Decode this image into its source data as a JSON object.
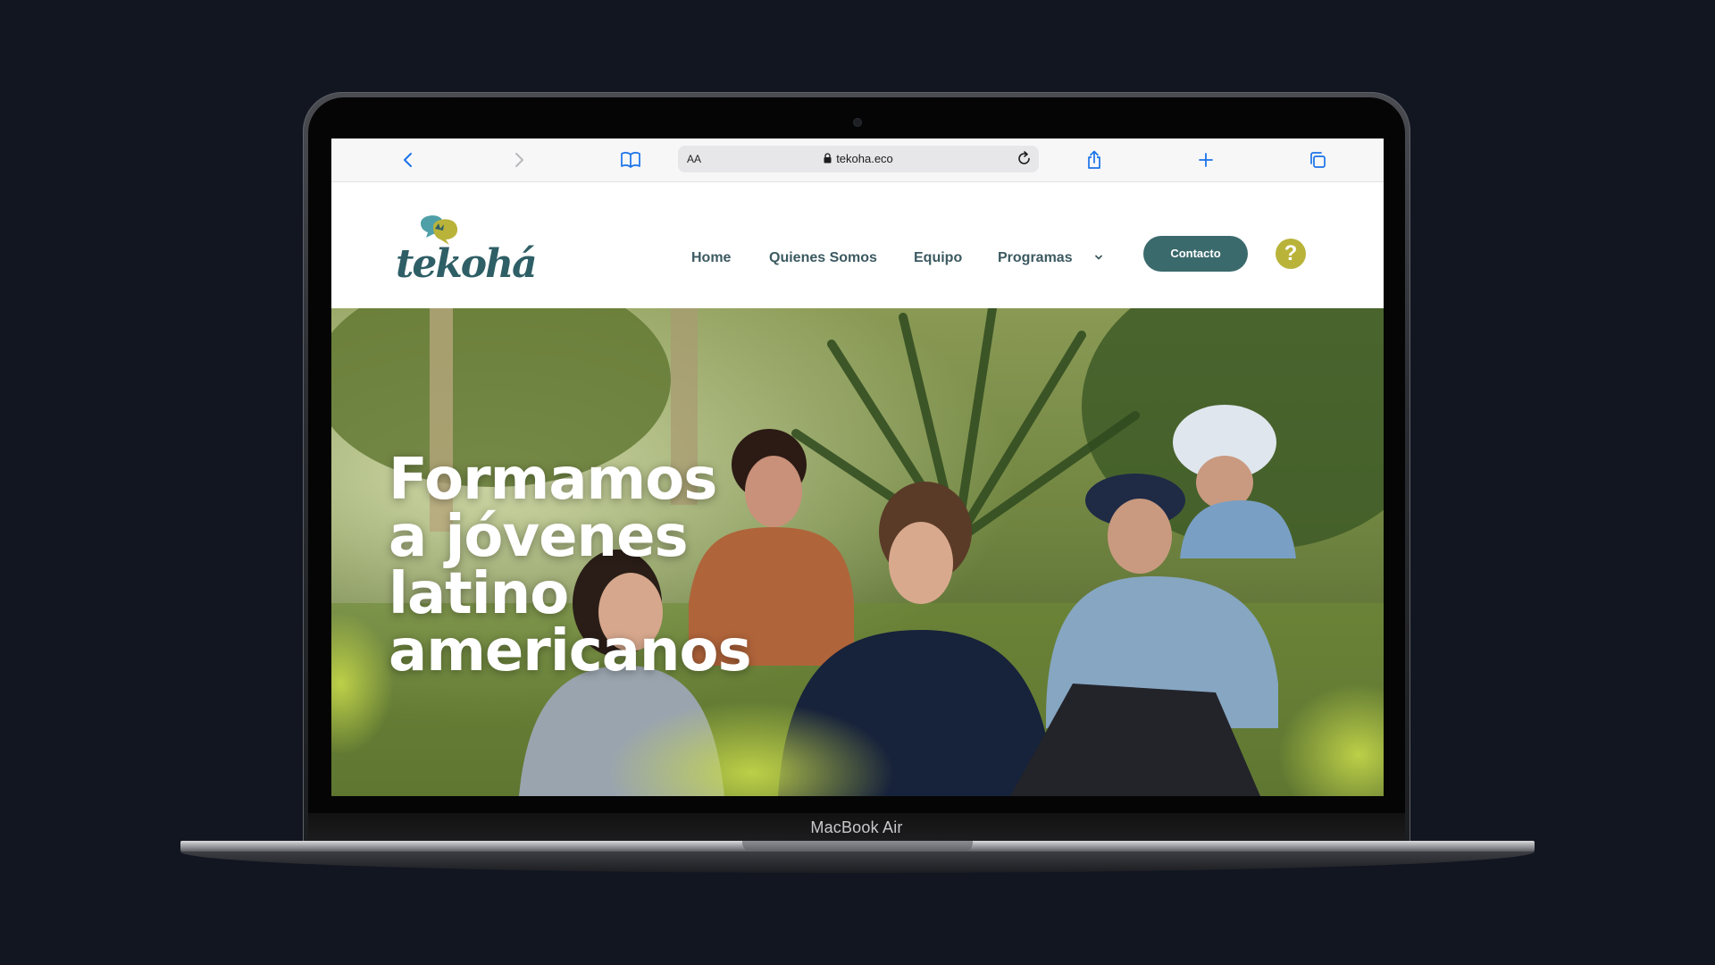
{
  "device": {
    "label": "MacBook Air"
  },
  "browser": {
    "reader_label": "AA",
    "url": "tekoha.eco",
    "buttons": [
      "back-icon",
      "forward-icon",
      "bookmarks-icon",
      "reload-icon",
      "share-icon",
      "new-tab-icon",
      "tabs-icon"
    ]
  },
  "site": {
    "logo_text": "tekohá",
    "nav": {
      "items": [
        "Home",
        "Quienes Somos",
        "Equipo",
        "Programas"
      ],
      "dropdown_icon": "chevron-down-icon"
    },
    "contact_label": "Contacto",
    "help_label": "?",
    "colors": {
      "primary": "#3b6a6d",
      "accent": "#b9b33a",
      "nav_text": "#3c5a61"
    }
  },
  "hero": {
    "title_lines": [
      "Formamos",
      "a jóvenes",
      "latino",
      "americanos"
    ]
  }
}
